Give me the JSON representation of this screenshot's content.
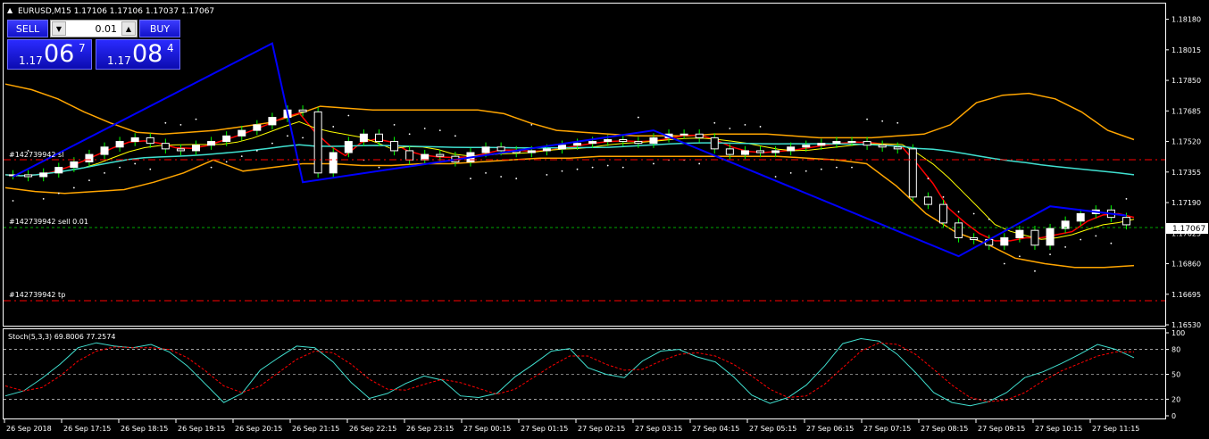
{
  "symbol_header": "EURUSD,M15  1.17106 1.17106 1.17037 1.17067",
  "trade_panel": {
    "sell_label": "SELL",
    "buy_label": "BUY",
    "lot_value": "0.01",
    "sell_quote": {
      "prefix": "1.17",
      "big": "06",
      "sup": "7"
    },
    "buy_quote": {
      "prefix": "1.17",
      "big": "08",
      "sup": "4"
    }
  },
  "order_lines": {
    "sl_label": "#142739942 sl",
    "sell_label": "#142739942 sell 0.01",
    "tp_label": "#142739942 tp"
  },
  "current_price_label": "1.17067",
  "price_axis": [
    "1.18180",
    "1.18015",
    "1.17850",
    "1.17685",
    "1.17520",
    "1.17355",
    "1.17190",
    "1.17025",
    "1.16860",
    "1.16695",
    "1.16530"
  ],
  "stoch_header": "Stoch(5,3,3) 69.8006 77.2574",
  "stoch_axis": [
    "100",
    "80",
    "50",
    "20",
    "0"
  ],
  "time_axis": [
    "26 Sep 2018",
    "26 Sep 17:15",
    "26 Sep 18:15",
    "26 Sep 19:15",
    "26 Sep 20:15",
    "26 Sep 21:15",
    "26 Sep 22:15",
    "26 Sep 23:15",
    "27 Sep 00:15",
    "27 Sep 01:15",
    "27 Sep 02:15",
    "27 Sep 03:15",
    "27 Sep 04:15",
    "27 Sep 05:15",
    "27 Sep 06:15",
    "27 Sep 07:15",
    "27 Sep 08:15",
    "27 Sep 09:15",
    "27 Sep 10:15",
    "27 Sep 11:15"
  ],
  "colors": {
    "background": "#000000",
    "bull_candle": "#ffffff",
    "wick": "#00ff00",
    "bollinger": "#ffa500",
    "ma_fast": "#ff0000",
    "ma_slow": "#ffff00",
    "ma_long": "#40e0d0",
    "zigzag": "#0000ff",
    "sar": "#ffffff",
    "stoch_main": "#40e0d0",
    "stoch_signal": "#ff0000",
    "sl_tp_line": "#ff0000",
    "entry_line": "#00aa00"
  },
  "chart_data": {
    "type": "candlestick",
    "symbol": "EURUSD",
    "timeframe": "M15",
    "ylim": [
      1.1653,
      1.1826
    ],
    "close_series": [
      1.1734,
      1.1733,
      1.1735,
      1.1738,
      1.1741,
      1.1745,
      1.1749,
      1.1752,
      1.1754,
      1.1751,
      1.1748,
      1.1747,
      1.175,
      1.1752,
      1.1755,
      1.1758,
      1.1761,
      1.1765,
      1.1769,
      1.1768,
      1.1735,
      1.1746,
      1.1752,
      1.1756,
      1.1752,
      1.1747,
      1.1742,
      1.1745,
      1.1744,
      1.1741,
      1.1746,
      1.1749,
      1.1747,
      1.1746,
      1.1747,
      1.1748,
      1.175,
      1.1751,
      1.1752,
      1.1753,
      1.1752,
      1.1751,
      1.1754,
      1.1756,
      1.1756,
      1.1754,
      1.1748,
      1.1745,
      1.1747,
      1.1746,
      1.1747,
      1.1749,
      1.175,
      1.1751,
      1.1752,
      1.1752,
      1.175,
      1.1749,
      1.1748,
      1.1722,
      1.1718,
      1.1708,
      1.17,
      1.1699,
      1.1696,
      1.17,
      1.1704,
      1.1696,
      1.1705,
      1.1709,
      1.1713,
      1.1715,
      1.1711,
      1.1707
    ],
    "bollinger_upper": [
      1.1783,
      1.178,
      1.1775,
      1.1768,
      1.1762,
      1.1757,
      1.1756,
      1.1757,
      1.1758,
      1.176,
      1.1762,
      1.1766,
      1.1771,
      1.177,
      1.1769,
      1.1769,
      1.1769,
      1.1769,
      1.1769,
      1.1767,
      1.1762,
      1.1758,
      1.1757,
      1.1756,
      1.1755,
      1.1755,
      1.1755,
      1.1756,
      1.1756,
      1.1756,
      1.1755,
      1.1754,
      1.1754,
      1.1754,
      1.1755,
      1.1756,
      1.1761,
      1.1773,
      1.1777,
      1.1778,
      1.1775,
      1.1768,
      1.1758,
      1.1753
    ],
    "bollinger_lower": [
      1.1727,
      1.1725,
      1.1724,
      1.1725,
      1.1726,
      1.173,
      1.1735,
      1.1742,
      1.1736,
      1.1738,
      1.174,
      1.174,
      1.1739,
      1.1739,
      1.174,
      1.174,
      1.1741,
      1.1742,
      1.1743,
      1.1743,
      1.1744,
      1.1744,
      1.1744,
      1.1744,
      1.1744,
      1.1744,
      1.1744,
      1.1743,
      1.1742,
      1.174,
      1.1728,
      1.1713,
      1.1703,
      1.1697,
      1.1689,
      1.1686,
      1.1684,
      1.1684,
      1.1685
    ],
    "zigzag": [
      [
        1.1733
      ],
      [
        1.1805
      ],
      [
        1.173
      ],
      [
        1.1758
      ],
      [
        1.169
      ],
      [
        1.1717
      ],
      [
        1.1712
      ]
    ],
    "stochastic": {
      "main": [
        24,
        30,
        45,
        62,
        82,
        88,
        84,
        82,
        86,
        77,
        60,
        38,
        16,
        27,
        55,
        70,
        84,
        82,
        65,
        40,
        21,
        27,
        39,
        48,
        43,
        24,
        22,
        27,
        47,
        62,
        78,
        81,
        58,
        50,
        46,
        66,
        78,
        80,
        71,
        65,
        47,
        25,
        15,
        22,
        37,
        60,
        87,
        93,
        90,
        74,
        52,
        28,
        16,
        12,
        17,
        28,
        46,
        53,
        63,
        74,
        86,
        80,
        70
      ],
      "signal": [
        36,
        30,
        34,
        48,
        66,
        78,
        83,
        82,
        82,
        80,
        70,
        54,
        36,
        28,
        36,
        52,
        68,
        78,
        76,
        62,
        44,
        32,
        31,
        38,
        44,
        40,
        33,
        26,
        32,
        46,
        60,
        72,
        72,
        62,
        55,
        56,
        66,
        74,
        76,
        72,
        62,
        48,
        32,
        22,
        24,
        38,
        58,
        78,
        88,
        86,
        74,
        56,
        37,
        22,
        17,
        19,
        28,
        42,
        54,
        63,
        72,
        77,
        77
      ],
      "levels": [
        80,
        50,
        20
      ],
      "ylim": [
        0,
        100
      ]
    }
  }
}
